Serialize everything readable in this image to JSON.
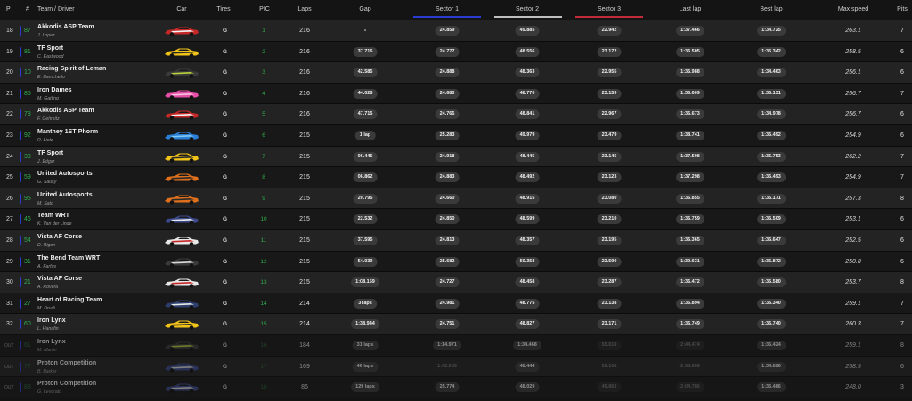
{
  "colors": {
    "accent_green": "#2fb04a",
    "sector1": "#2a3bd1",
    "sector2": "#bfbfbf",
    "sector3": "#c22b3a"
  },
  "headers": {
    "pos": "P",
    "num": "#",
    "team": "Team / Driver",
    "car": "Car",
    "tires": "Tires",
    "pic": "PIC",
    "laps": "Laps",
    "gap": "Gap",
    "s1": "Sector 1",
    "s2": "Sector 2",
    "s3": "Sector 3",
    "last": "Last lap",
    "best": "Best lap",
    "speed": "Max speed",
    "pits": "Pits"
  },
  "rows": [
    {
      "pos": "18",
      "strip": "#2a3bd1",
      "num": "87",
      "team": "Akkodis ASP Team",
      "driver": "J. Lopez",
      "car_colors": [
        "#c62828",
        "#f2f2f2"
      ],
      "tire": "G",
      "pic": "1",
      "laps": "216",
      "gap": "-",
      "s1": "24.859",
      "s2": "49.885",
      "s3": "22.942",
      "last": "1:37.466",
      "best": "1:34.725",
      "speed": "263.1",
      "pits": "7",
      "out": false
    },
    {
      "pos": "19",
      "strip": "#2a3bd1",
      "num": "81",
      "team": "TF Sport",
      "driver": "C. Eastwood",
      "car_colors": [
        "#f2c318",
        "#2a2a2a"
      ],
      "tire": "G",
      "pic": "2",
      "laps": "216",
      "gap": "37.716",
      "s1": "24.777",
      "s2": "48.556",
      "s3": "23.172",
      "last": "1:36.505",
      "best": "1:35.342",
      "speed": "258.5",
      "pits": "6",
      "out": false
    },
    {
      "pos": "20",
      "strip": "#2a3bd1",
      "num": "10",
      "team": "Racing Spirit of Leman",
      "driver": "E. Barrichello",
      "car_colors": [
        "#3a3a3a",
        "#b8d23a"
      ],
      "tire": "G",
      "pic": "3",
      "laps": "216",
      "gap": "42.585",
      "s1": "24.888",
      "s2": "48.363",
      "s3": "22.955",
      "last": "1:35.988",
      "best": "1:34.463",
      "speed": "256.1",
      "pits": "6",
      "out": false
    },
    {
      "pos": "21",
      "strip": "#2a3bd1",
      "num": "85",
      "team": "Iron Dames",
      "driver": "M. Gatting",
      "car_colors": [
        "#e64fa7",
        "#f6c2e0"
      ],
      "tire": "G",
      "pic": "4",
      "laps": "216",
      "gap": "44.028",
      "s1": "24.680",
      "s2": "48.770",
      "s3": "23.159",
      "last": "1:36.609",
      "best": "1:35.131",
      "speed": "256.7",
      "pits": "7",
      "out": false
    },
    {
      "pos": "22",
      "strip": "#2a3bd1",
      "num": "78",
      "team": "Akkodis ASP Team",
      "driver": "F. Gehrsitz",
      "car_colors": [
        "#c62828",
        "#f2f2f2"
      ],
      "tire": "G",
      "pic": "5",
      "laps": "216",
      "gap": "47.715",
      "s1": "24.765",
      "s2": "48.841",
      "s3": "22.967",
      "last": "1:36.673",
      "best": "1:34.978",
      "speed": "256.7",
      "pits": "6",
      "out": false
    },
    {
      "pos": "23",
      "strip": "#2a3bd1",
      "num": "92",
      "team": "Manthey 1ST Phorm",
      "driver": "R. Lietz",
      "car_colors": [
        "#2a7fd4",
        "#7fc8f2"
      ],
      "tire": "G",
      "pic": "6",
      "laps": "215",
      "gap": "1 lap",
      "s1": "25.283",
      "s2": "49.979",
      "s3": "23.479",
      "last": "1:38.741",
      "best": "1:35.492",
      "speed": "254.9",
      "pits": "6",
      "out": false
    },
    {
      "pos": "24",
      "strip": "#2a3bd1",
      "num": "33",
      "team": "TF Sport",
      "driver": "J. Edgar",
      "car_colors": [
        "#f2c318",
        "#2a2a2a"
      ],
      "tire": "G",
      "pic": "7",
      "laps": "215",
      "gap": "06.445",
      "s1": "24.918",
      "s2": "48.445",
      "s3": "23.145",
      "last": "1:37.508",
      "best": "1:35.753",
      "speed": "262.2",
      "pits": "7",
      "out": false
    },
    {
      "pos": "25",
      "strip": "#2a3bd1",
      "num": "59",
      "team": "United Autosports",
      "driver": "G. Saucy",
      "car_colors": [
        "#e0701c",
        "#2a2a2a"
      ],
      "tire": "G",
      "pic": "8",
      "laps": "215",
      "gap": "06.862",
      "s1": "24.883",
      "s2": "48.492",
      "s3": "23.123",
      "last": "1:37.298",
      "best": "1:35.493",
      "speed": "254.9",
      "pits": "7",
      "out": false
    },
    {
      "pos": "26",
      "strip": "#2a3bd1",
      "num": "95",
      "team": "United Autosports",
      "driver": "M. Sato",
      "car_colors": [
        "#e0701c",
        "#2a2a2a"
      ],
      "tire": "G",
      "pic": "9",
      "laps": "215",
      "gap": "20.795",
      "s1": "24.660",
      "s2": "48.915",
      "s3": "23.080",
      "last": "1:36.855",
      "best": "1:35.171",
      "speed": "257.3",
      "pits": "8",
      "out": false
    },
    {
      "pos": "27",
      "strip": "#2a3bd1",
      "num": "46",
      "team": "Team WRT",
      "driver": "K. Van der Linde",
      "car_colors": [
        "#3c4a8c",
        "#e8e8e8"
      ],
      "tire": "G",
      "pic": "10",
      "laps": "215",
      "gap": "22.532",
      "s1": "24.850",
      "s2": "48.599",
      "s3": "23.210",
      "last": "1:36.759",
      "best": "1:35.509",
      "speed": "253.1",
      "pits": "6",
      "out": false
    },
    {
      "pos": "28",
      "strip": "#2a3bd1",
      "num": "54",
      "team": "Vista AF Corse",
      "driver": "D. Rigon",
      "car_colors": [
        "#e8e8e8",
        "#c62828"
      ],
      "tire": "G",
      "pic": "11",
      "laps": "215",
      "gap": "37.595",
      "s1": "24.813",
      "s2": "48.357",
      "s3": "23.195",
      "last": "1:36.365",
      "best": "1:35.647",
      "speed": "252.5",
      "pits": "6",
      "out": false
    },
    {
      "pos": "29",
      "strip": "#2a3bd1",
      "num": "31",
      "team": "The Bend Team WRT",
      "driver": "A. Farfus",
      "car_colors": [
        "#3a3a3a",
        "#d8d8d8"
      ],
      "tire": "G",
      "pic": "12",
      "laps": "215",
      "gap": "54.039",
      "s1": "25.682",
      "s2": "50.358",
      "s3": "23.590",
      "last": "1:39.631",
      "best": "1:35.872",
      "speed": "250.8",
      "pits": "6",
      "out": false
    },
    {
      "pos": "30",
      "strip": "#2a3bd1",
      "num": "21",
      "team": "Vista AF Corse",
      "driver": "A. Rovera",
      "car_colors": [
        "#e8e8e8",
        "#c62828"
      ],
      "tire": "G",
      "pic": "13",
      "laps": "215",
      "gap": "1:08.159",
      "s1": "24.727",
      "s2": "48.458",
      "s3": "23.287",
      "last": "1:36.472",
      "best": "1:35.580",
      "speed": "253.7",
      "pits": "8",
      "out": false
    },
    {
      "pos": "31",
      "strip": "#2a3bd1",
      "num": "27",
      "team": "Heart of Racing Team",
      "driver": "M. Drudi",
      "car_colors": [
        "#2e3f6e",
        "#e8e8e8"
      ],
      "tire": "G",
      "pic": "14",
      "laps": "214",
      "gap": "3 laps",
      "s1": "24.981",
      "s2": "48.775",
      "s3": "23.138",
      "last": "1:36.894",
      "best": "1:35.340",
      "speed": "259.1",
      "pits": "7",
      "out": false
    },
    {
      "pos": "32",
      "strip": "#2a3bd1",
      "num": "60",
      "team": "Iron Lynx",
      "driver": "L. Hanafin",
      "car_colors": [
        "#f2c318",
        "#2a2a2a"
      ],
      "tire": "G",
      "pic": "15",
      "laps": "214",
      "gap": "1:38.944",
      "s1": "24.751",
      "s2": "48.827",
      "s3": "23.171",
      "last": "1:36.749",
      "best": "1:35.740",
      "speed": "260.3",
      "pits": "7",
      "out": false
    },
    {
      "pos": "OUT",
      "strip": "#2a3bd1",
      "num": "61",
      "team": "Iron Lynx",
      "driver": "M. Martin",
      "car_colors": [
        "#3a3a3a",
        "#b8d23a"
      ],
      "tire": "G",
      "pic": "16",
      "laps": "184",
      "gap": "31 laps",
      "s1": "1:14.971",
      "s2": "1:34.468",
      "s3": "55.018",
      "last": "2:44.474",
      "best": "1:35.424",
      "speed": "259.1",
      "pits": "8",
      "out": true,
      "s1_dim": false,
      "s2_dim": false,
      "s3_dim": true,
      "last_dim": true
    },
    {
      "pos": "OUT",
      "strip": "#2a3bd1",
      "num": "77",
      "team": "Proton Competition",
      "driver": "B. Barker",
      "car_colors": [
        "#3c4a8c",
        "#d8d8d8"
      ],
      "tire": "G",
      "pic": "17",
      "laps": "169",
      "gap": "46 laps",
      "s1": "1:42.255",
      "s2": "48.444",
      "s3": "28.108",
      "last": "2:58.808",
      "best": "1:34.826",
      "speed": "258.5",
      "pits": "6",
      "out": true,
      "s1_dim": true,
      "s2_dim": false,
      "s3_dim": true,
      "last_dim": true
    },
    {
      "pos": "OUT",
      "strip": "#2a3bd1",
      "num": "88",
      "team": "Proton Competition",
      "driver": "G. Levorato",
      "car_colors": [
        "#3c4a8c",
        "#d8d8d8"
      ],
      "tire": "G",
      "pic": "18",
      "laps": "86",
      "gap": "129 laps",
      "s1": "25.774",
      "s2": "48.029",
      "s3": "49.863",
      "last": "2:04.786",
      "best": "1:35.486",
      "speed": "248.0",
      "pits": "3",
      "out": true,
      "s1_dim": false,
      "s2_dim": false,
      "s3_dim": true,
      "last_dim": true
    }
  ]
}
